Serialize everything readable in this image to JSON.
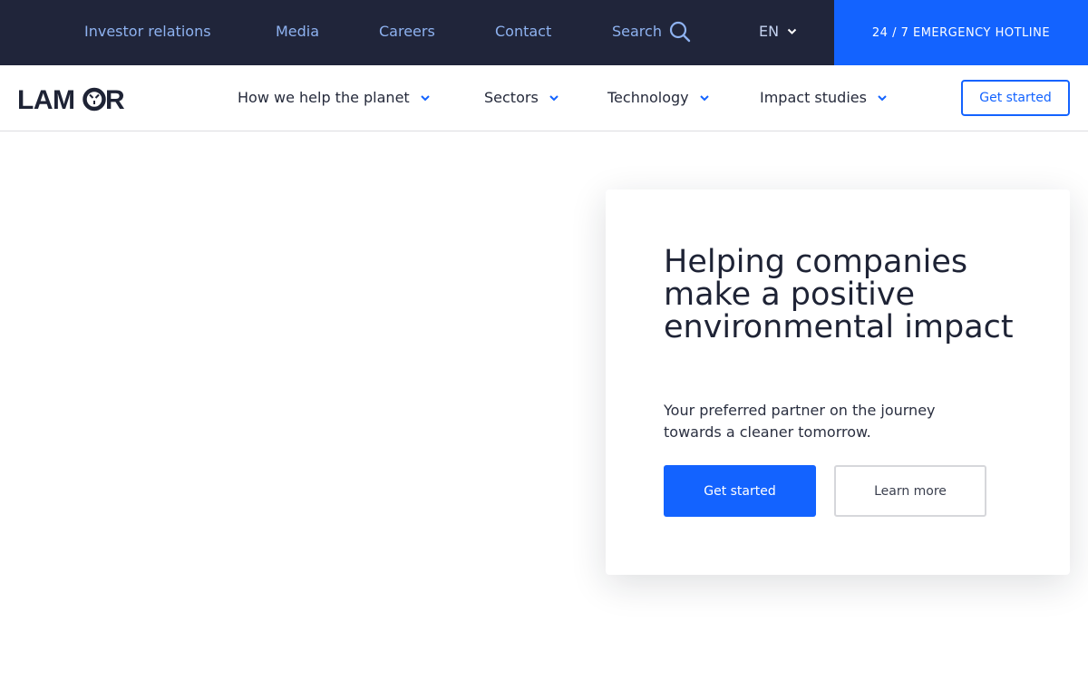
{
  "topbar": {
    "links": [
      "Investor relations",
      "Media",
      "Careers",
      "Contact"
    ],
    "search_label": "Search",
    "search_icon": "search-icon",
    "language": "EN",
    "hotline_label": "24 / 7 EMERGENCY HOTLINE"
  },
  "nav": {
    "logo_text": "LAMOR",
    "items": [
      "How we help the planet",
      "Sectors",
      "Technology",
      "Impact studies"
    ],
    "cta_label": "Get started"
  },
  "hero": {
    "title": "Helping companies make a positive environmental impact",
    "subtitle": "Your preferred partner on the journey towards a cleaner tomorrow.",
    "primary_button": "Get started",
    "secondary_button": "Learn more"
  },
  "colors": {
    "topbar_bg": "#20253a",
    "accent": "#1363ff",
    "top_link": "#8eb2f0"
  }
}
